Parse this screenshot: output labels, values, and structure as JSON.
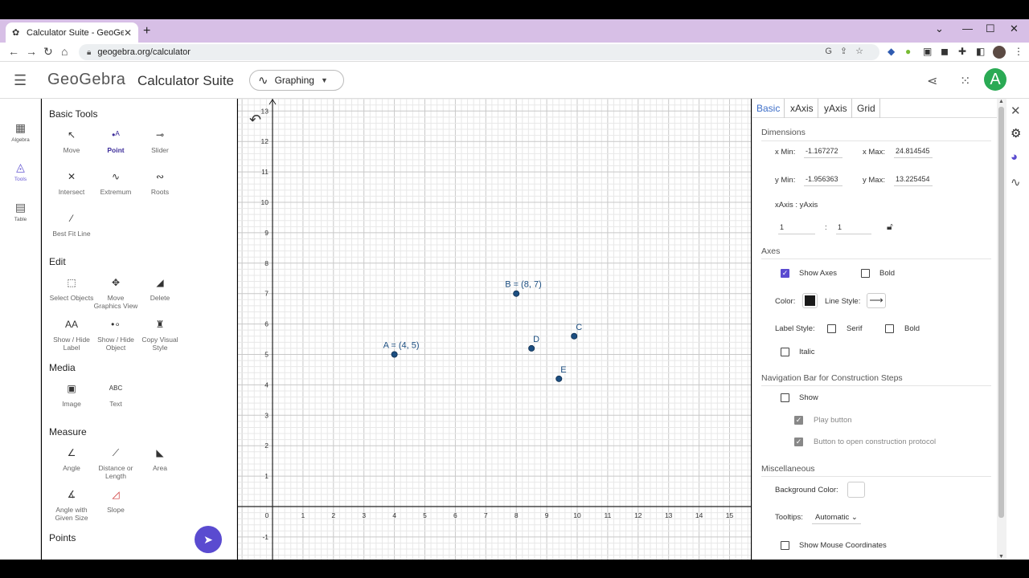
{
  "browser": {
    "tab_title": "Calculator Suite - GeoGebra",
    "tab_favicon": "geogebra-icon",
    "url": "geogebra.org/calculator",
    "new_tab": "+",
    "window_controls": [
      "⌄",
      "—",
      "☐",
      "✕"
    ]
  },
  "header": {
    "logo": "GeoGebra",
    "suite_title": "Calculator Suite",
    "app_selector": "Graphing",
    "avatar_letter": "A",
    "accent": "#5a4bd0",
    "avatar_color": "#2aaa54"
  },
  "rail": {
    "items": [
      {
        "label": "Algebra",
        "icon": "calculator-icon"
      },
      {
        "label": "Tools",
        "icon": "shapes-icon"
      },
      {
        "label": "Table",
        "icon": "table-icon"
      }
    ]
  },
  "tools": {
    "sections": [
      "Basic Tools",
      "Edit",
      "Media",
      "Measure",
      "Points"
    ],
    "basic": [
      "Move",
      "Point",
      "Slider",
      "Intersect",
      "Extremum",
      "Roots",
      "Best Fit Line"
    ],
    "edit": [
      "Select Objects",
      "Move\nGraphics View",
      "Delete",
      "Show / Hide\nLabel",
      "Show / Hide\nObject",
      "Copy Visual\nStyle"
    ],
    "media": [
      "Image",
      "Text"
    ],
    "measure": [
      "Angle",
      "Distance or\nLength",
      "Area",
      "Angle with\nGiven Size",
      "Slope"
    ],
    "text_icon": "ABC",
    "label_icon": "AA"
  },
  "graph": {
    "x_ticks": [
      0,
      1,
      2,
      3,
      4,
      5,
      6,
      7,
      8,
      9,
      10,
      11,
      12,
      13,
      14,
      15
    ],
    "y_ticks": [
      -1,
      1,
      2,
      3,
      4,
      5,
      6,
      7,
      8,
      9,
      10,
      11,
      12,
      13
    ],
    "points": [
      {
        "name": "A",
        "x": 4,
        "y": 5,
        "label": "A = (4, 5)"
      },
      {
        "name": "B",
        "x": 8,
        "y": 7,
        "label": "B = (8, 7)"
      },
      {
        "name": "C",
        "x": 9.9,
        "y": 5.6,
        "label": "C"
      },
      {
        "name": "D",
        "x": 8.5,
        "y": 5.2,
        "label": "D"
      },
      {
        "name": "E",
        "x": 9.4,
        "y": 4.2,
        "label": "E"
      }
    ],
    "point_color": "#1c4e80"
  },
  "settings": {
    "tabs": [
      "Basic",
      "xAxis",
      "yAxis",
      "Grid"
    ],
    "dimensions": {
      "heading": "Dimensions",
      "xmin_label": "x Min:",
      "xmin": "-1.167272",
      "xmax_label": "x Max:",
      "xmax": "24.814545",
      "ymin_label": "y Min:",
      "ymin": "-1.956363",
      "ymax_label": "y Max:",
      "ymax": "13.225454",
      "ratio_label": "xAxis : yAxis",
      "ratio_x": "1",
      "ratio_sep": ":",
      "ratio_y": "1"
    },
    "axes": {
      "heading": "Axes",
      "show_axes": "Show Axes",
      "bold": "Bold",
      "color_label": "Color:",
      "line_style_label": "Line Style:",
      "label_style": "Label Style:",
      "serif": "Serif",
      "bold2": "Bold",
      "italic": "Italic"
    },
    "nav": {
      "heading": "Navigation Bar for Construction Steps",
      "show": "Show",
      "play": "Play button",
      "protocol": "Button to open construction protocol"
    },
    "misc": {
      "heading": "Miscellaneous",
      "bg_color": "Background Color:",
      "tooltips": "Tooltips:",
      "tooltips_value": "Automatic",
      "mouse_coords": "Show Mouse Coordinates"
    }
  }
}
